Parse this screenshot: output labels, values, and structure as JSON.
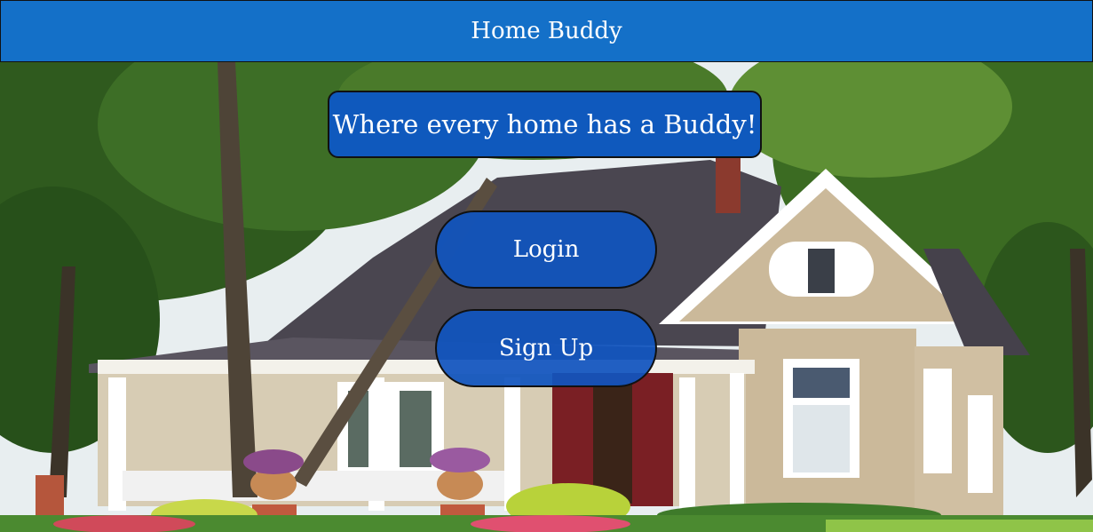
{
  "header": {
    "title": "Home Buddy"
  },
  "hero": {
    "tagline": "Where every home has a Buddy!"
  },
  "actions": {
    "login_label": "Login",
    "signup_label": "Sign Up"
  },
  "colors": {
    "header_bg": "#1470c8",
    "button_bg": "#1054be",
    "text": "#ffffff",
    "border": "#111111"
  },
  "background": {
    "description_icon": "house-photo"
  }
}
